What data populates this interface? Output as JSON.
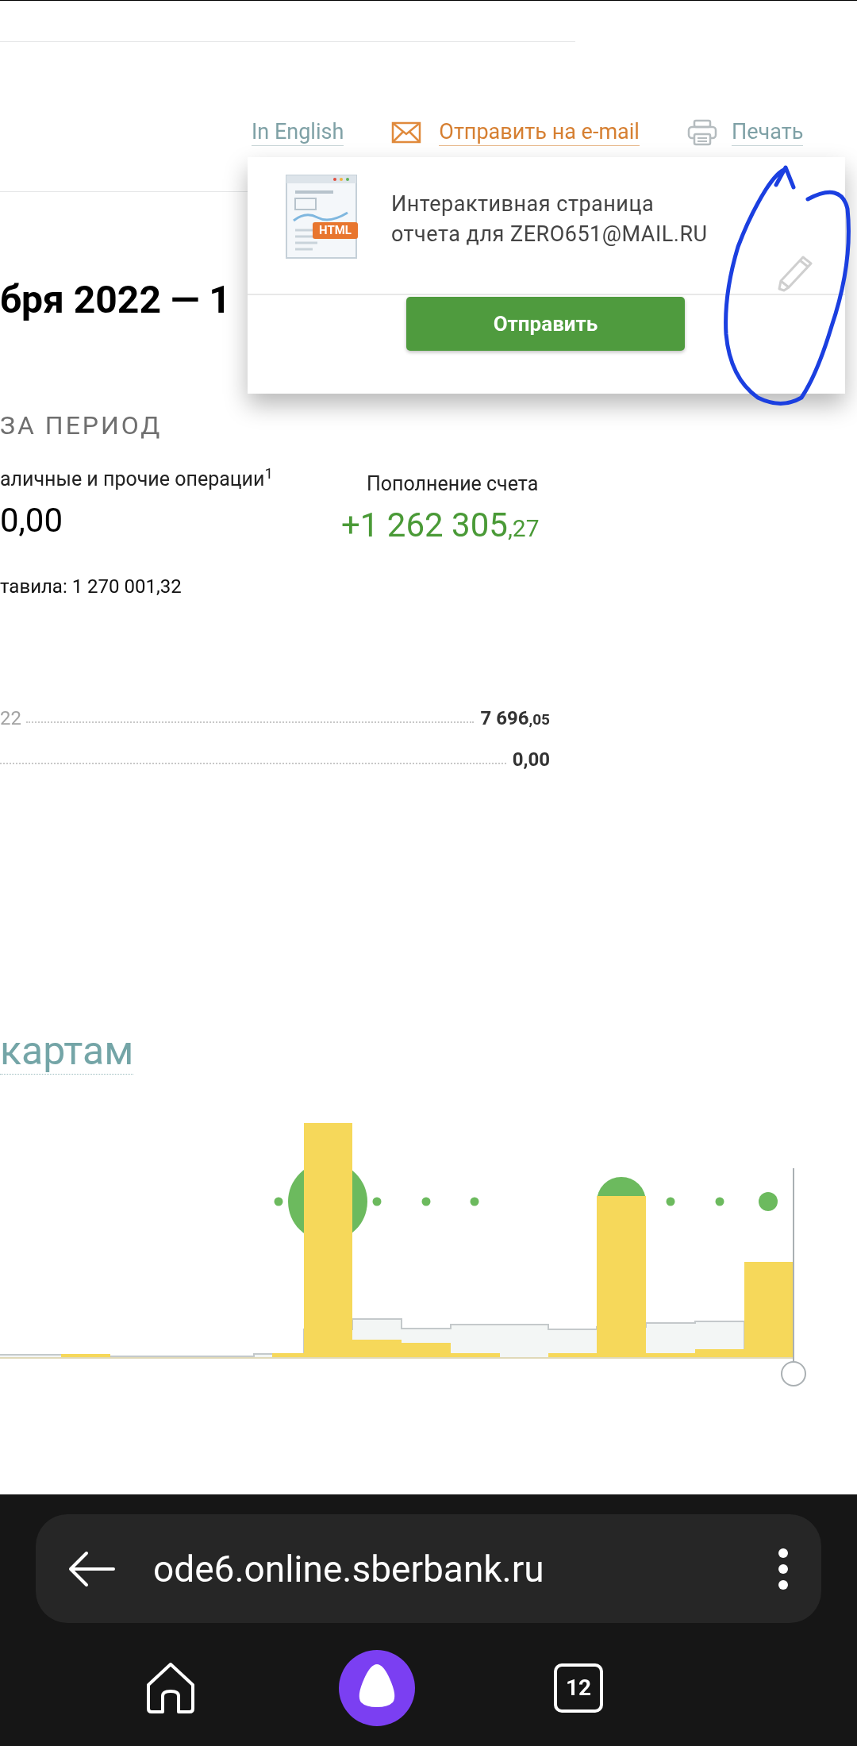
{
  "header_links": [
    {
      "kind": "language",
      "label": "In English"
    },
    {
      "kind": "email",
      "label": "Отправить на e-mail"
    },
    {
      "kind": "print",
      "label": "Печать"
    }
  ],
  "email_popup": {
    "description": "Интерактивная страница отчета для ZERO651@MAIL.RU",
    "file_badge": "HTML",
    "send_button": "Отправить"
  },
  "period_title": "бря 2022 — 1",
  "section_title": "ЗА ПЕРИОД",
  "summary": [
    {
      "label": "аличные и прочие операции$^{1}$",
      "main": "0,00",
      "positive": false
    },
    {
      "label": "Пополнение счета",
      "main": "+1 262 305",
      "fraction": ",27",
      "positive": true
    }
  ],
  "total_note": "тавила: 1 270 001,32",
  "balances": [
    {
      "label": "22",
      "main": "7 696",
      "fraction": ",05"
    },
    {
      "main": "0,00"
    }
  ],
  "cards_link": "картам",
  "browser": {
    "url": "ode6.online.sberbank.ru",
    "tab_count": "12"
  }
}
